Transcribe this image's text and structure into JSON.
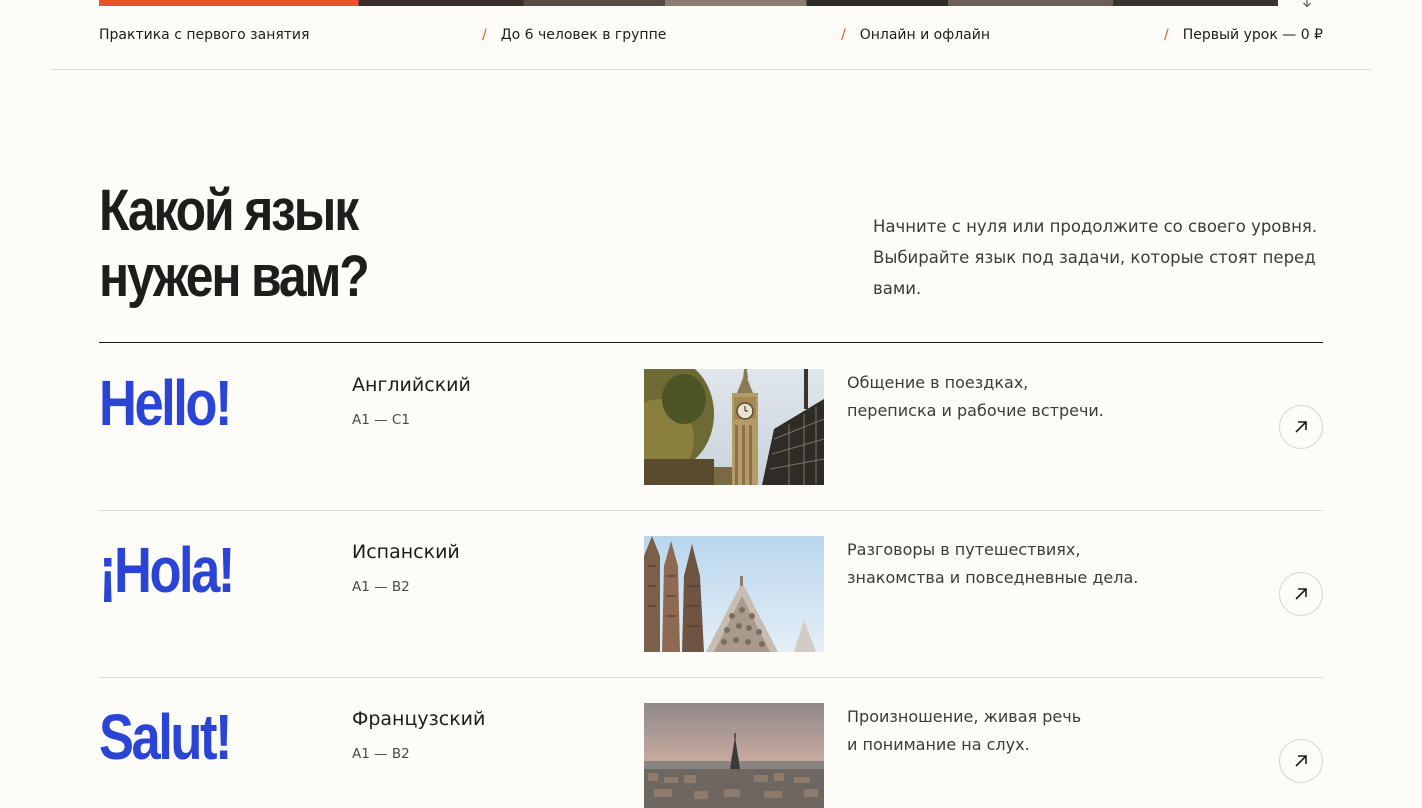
{
  "features": [
    "Практика с первого занятия",
    "До 6 человек в группе",
    "Онлайн и офлайн",
    "Первый урок — 0 ₽"
  ],
  "section": {
    "title_line1": "Какой язык",
    "title_line2": "нужен вам?",
    "intro_line1": "Начните с нуля или продолжите со своего уровня.",
    "intro_line2": "Выбирайте язык под задачи, которые стоят перед",
    "intro_line3": "вами."
  },
  "languages": [
    {
      "greeting": "Hello!",
      "name": "Английский",
      "level": "A1 — C1",
      "photo_icon": "big-ben-photo",
      "desc_line1": "Общение в поездках,",
      "desc_line2": "переписка и рабочие встречи."
    },
    {
      "greeting": "¡Hola!",
      "name": "Испанский",
      "level": "A1 — B2",
      "photo_icon": "sagrada-familia-photo",
      "desc_line1": "Разговоры в путешествиях,",
      "desc_line2": "знакомства и повседневные дела."
    },
    {
      "greeting": "Salut!",
      "name": "Французский",
      "level": "A1 — B2",
      "photo_icon": "paris-eiffel-photo",
      "desc_line1": "Произношение, живая речь",
      "desc_line2": "и понимание на слух."
    }
  ],
  "colors": {
    "accent": "#e9512f",
    "greeting_blue": "#2a45d6",
    "background": "#fdfcf8",
    "text": "#1d1d1b"
  }
}
